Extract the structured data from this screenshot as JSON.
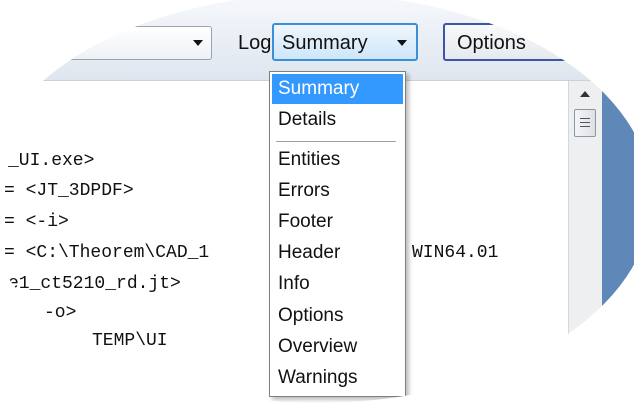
{
  "toolbar": {
    "log_label": "Log:",
    "log_selected": "Summary",
    "options_label": "Options"
  },
  "log_dropdown": {
    "items": [
      "Summary",
      "Details",
      "Entities",
      "Errors",
      "Footer",
      "Header",
      "Info",
      "Options",
      "Overview",
      "Warnings"
    ],
    "highlighted": "Summary"
  },
  "log_text": {
    "lines": [
      "_UI.exe>",
      "= <JT_3DPDF>",
      "= <-i>",
      "= <C:\\Theorem\\CAD_1",
      "WIN64.01",
      "e1_ct5210_rd.jt>",
      "-o>",
      "TEMP\\UI"
    ]
  },
  "colors": {
    "selection": "#3399ff",
    "focus_border": "#3b8fd6",
    "right_panel": "#5f87b8"
  }
}
